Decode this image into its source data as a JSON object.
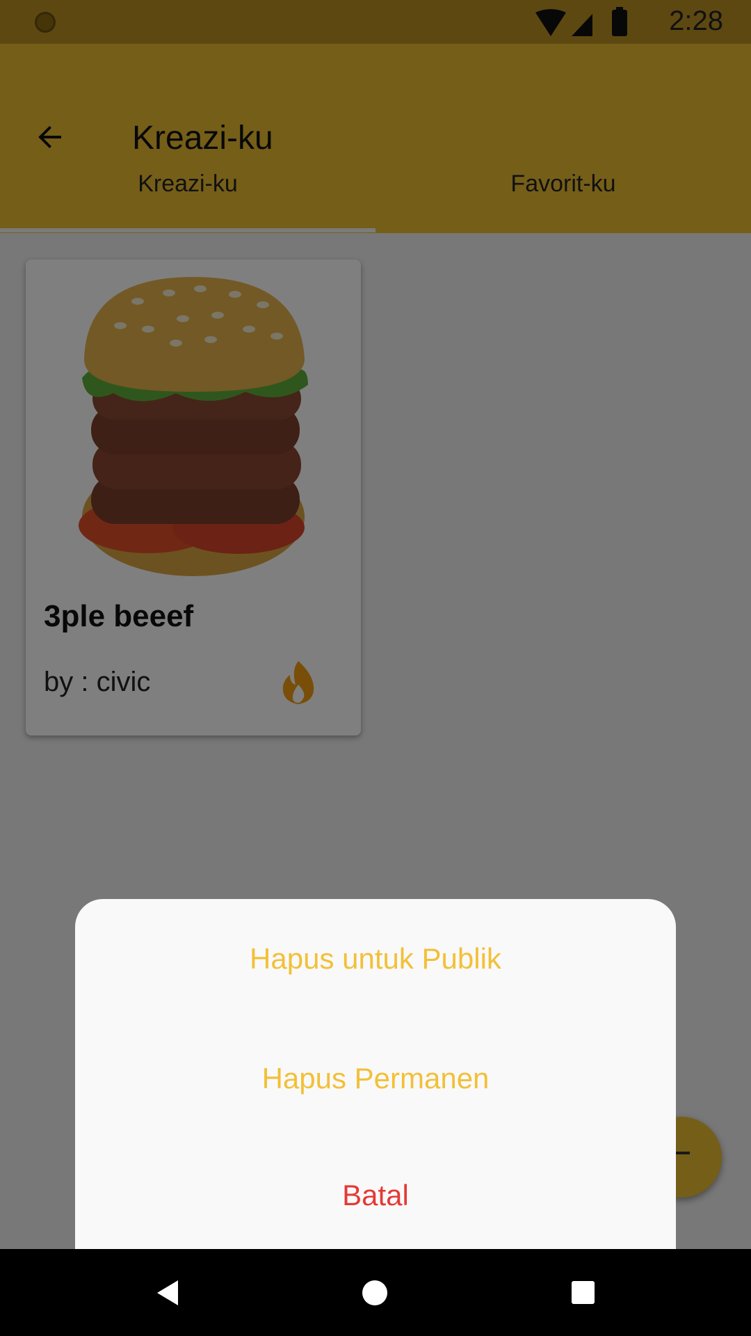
{
  "status_bar": {
    "time": "2:28"
  },
  "app_bar": {
    "title": "Kreazi-ku",
    "tabs": [
      {
        "label": "Kreazi-ku",
        "selected": true
      },
      {
        "label": "Favorit-ku",
        "selected": false
      }
    ]
  },
  "recipe_card": {
    "title": "3ple beeef",
    "author": "by : civic",
    "image_icon": "burger-image",
    "badge_icon": "fire-icon"
  },
  "dialog": {
    "options": [
      {
        "label": "Hapus untuk Publik"
      },
      {
        "label": "Hapus Permanen"
      },
      {
        "label": "Batal"
      }
    ]
  },
  "colors": {
    "accent": "#ebbd31",
    "option_text": "#f2c038",
    "cancel_text": "#e53935"
  }
}
